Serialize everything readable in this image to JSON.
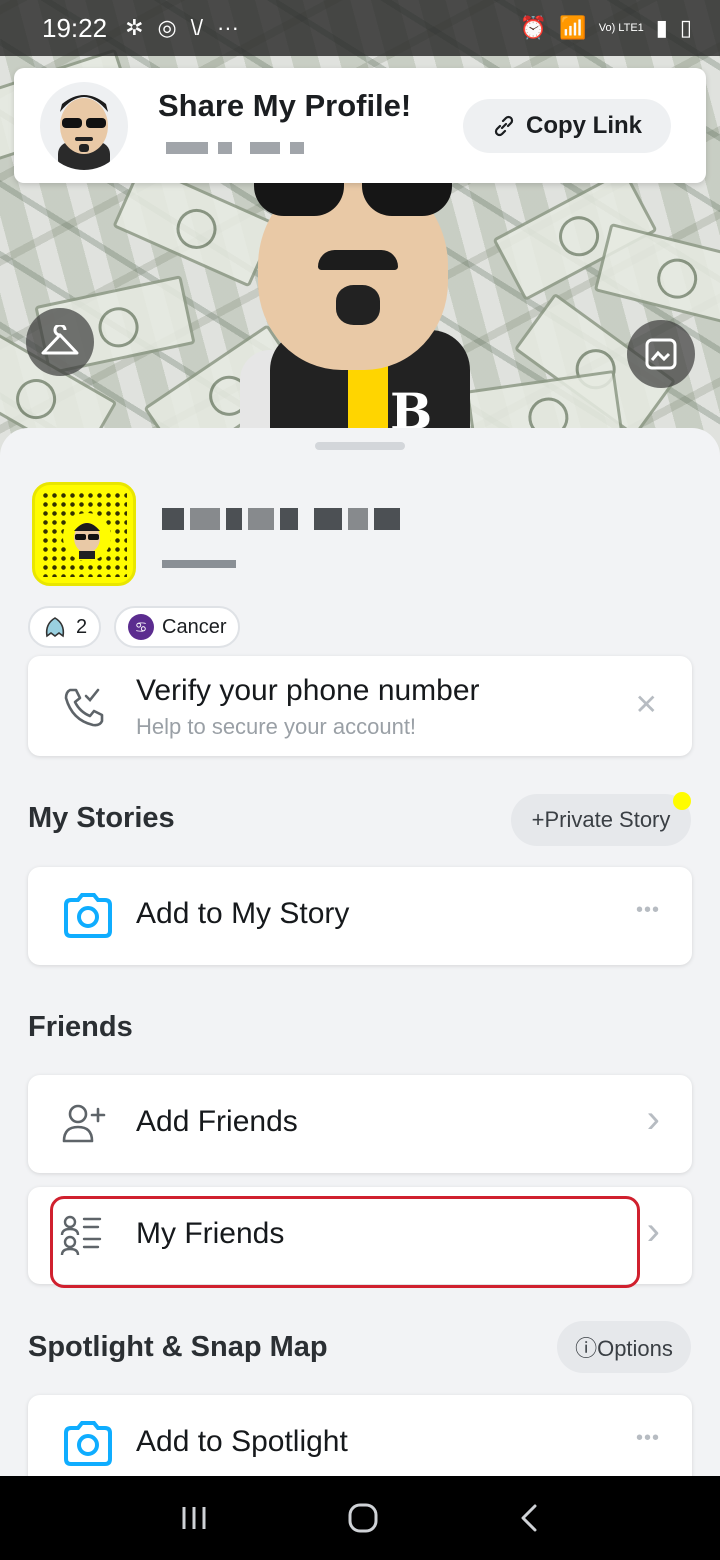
{
  "status_bar": {
    "time": "19:22",
    "network": "Vo) LTE1"
  },
  "share_card": {
    "title": "Share My Profile!",
    "copy_link_label": "Copy Link"
  },
  "chips": {
    "friends_count": "2",
    "zodiac": "Cancer"
  },
  "verify_card": {
    "title": "Verify your phone number",
    "subtitle": "Help to secure your account!",
    "dismiss": "✕"
  },
  "stories": {
    "section_title": "My Stories",
    "private_story_label": "+Private Story",
    "add_label": "Add to My Story",
    "more": "•••"
  },
  "friends": {
    "section_title": "Friends",
    "add_friends_label": "Add Friends",
    "my_friends_label": "My Friends",
    "chevron": "›"
  },
  "spotlight": {
    "section_title": "Spotlight & Snap Map",
    "options_label": "ⓘOptions",
    "add_label": "Add to Spotlight",
    "more": "•••"
  },
  "colors": {
    "accent_blue": "#0fadff",
    "snap_yellow": "#fffc00",
    "highlight_red": "#d0202e",
    "zodiac_purple": "#5b2c8f"
  },
  "icons": [
    "hanger-icon",
    "image-frame-icon",
    "link-icon",
    "phone-check-icon",
    "camera-icon",
    "add-friend-icon",
    "friends-list-icon"
  ]
}
